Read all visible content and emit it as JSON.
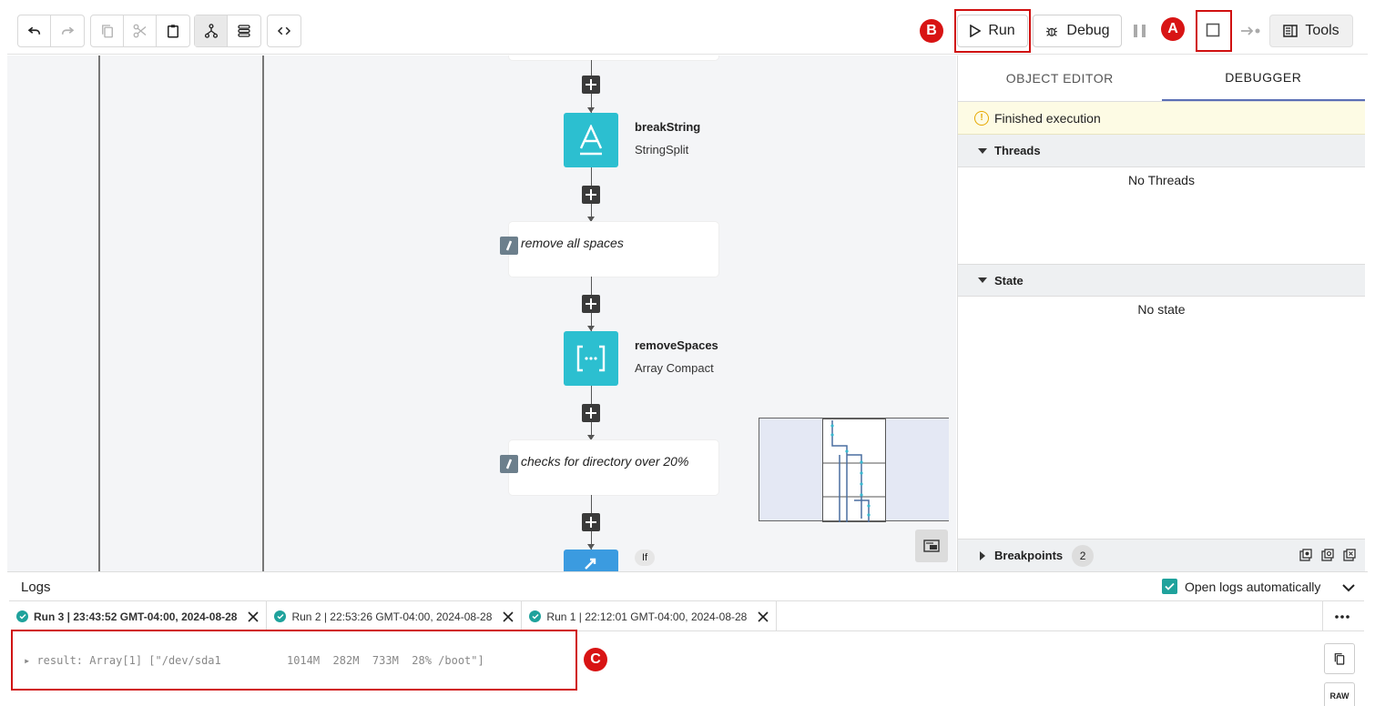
{
  "toolbar": {
    "run_label": "Run",
    "debug_label": "Debug",
    "tools_label": "Tools"
  },
  "markers": {
    "a": "A",
    "b": "B",
    "c": "C"
  },
  "flow": {
    "nodes": [
      {
        "title": "breakString",
        "subtitle": "StringSplit",
        "icon": "text-icon"
      },
      {
        "title": "removeSpaces",
        "subtitle": "Array Compact",
        "icon": "array-compact-icon"
      },
      {
        "badge": "If",
        "icon": "if-icon"
      }
    ],
    "comments": [
      "remove all spaces",
      "checks for directory over 20%"
    ]
  },
  "panel": {
    "tabs": [
      "OBJECT EDITOR",
      "DEBUGGER"
    ],
    "active_tab": "DEBUGGER",
    "status": "Finished execution",
    "threads_label": "Threads",
    "threads_empty": "No Threads",
    "state_label": "State",
    "state_empty": "No state",
    "breakpoints_label": "Breakpoints",
    "breakpoints_count": "2"
  },
  "logs": {
    "title": "Logs",
    "open_auto_label": "Open logs automatically",
    "open_auto_checked": true,
    "runs": [
      {
        "label": "Run 3 | 23:43:52 GMT-04:00, 2024-08-28",
        "active": true
      },
      {
        "label": "Run 2 | 22:53:26 GMT-04:00, 2024-08-28",
        "active": false
      },
      {
        "label": "Run 1 | 22:12:01 GMT-04:00, 2024-08-28",
        "active": false
      }
    ],
    "result_line": "▸ result: Array[1] [\"/dev/sda1          1014M  282M  733M  28% /boot\"]",
    "raw_label": "RAW"
  },
  "colors": {
    "accent": "#2cbfd0",
    "if_node": "#3b9be0",
    "success": "#1fa29c",
    "annotation": "#d01010"
  }
}
